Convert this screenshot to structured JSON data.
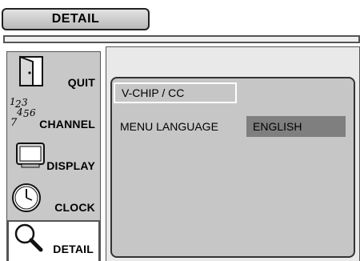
{
  "header": {
    "title": "DETAIL"
  },
  "sidebar": {
    "items": [
      {
        "label": "QUIT",
        "icon": "door-icon"
      },
      {
        "label": "CHANNEL",
        "icon": "channel-numbers-icon"
      },
      {
        "label": "DISPLAY",
        "icon": "tv-screen-icon"
      },
      {
        "label": "CLOCK",
        "icon": "clock-icon"
      },
      {
        "label": "DETAIL",
        "icon": "magnifier-icon"
      }
    ],
    "active": "DETAIL",
    "channel_icon_digits": [
      "1",
      "2",
      "3",
      "4",
      "5",
      "6",
      "7"
    ]
  },
  "menu": {
    "items": [
      {
        "label": "V-CHIP / CC",
        "selected": true
      },
      {
        "label": "MENU LANGUAGE",
        "value": "ENGLISH"
      }
    ]
  },
  "colors": {
    "panel": "#c6c6c6",
    "value_box": "#7f7f7f",
    "selection_border": "#ffffff",
    "sidebar": "#c8c8c8"
  }
}
